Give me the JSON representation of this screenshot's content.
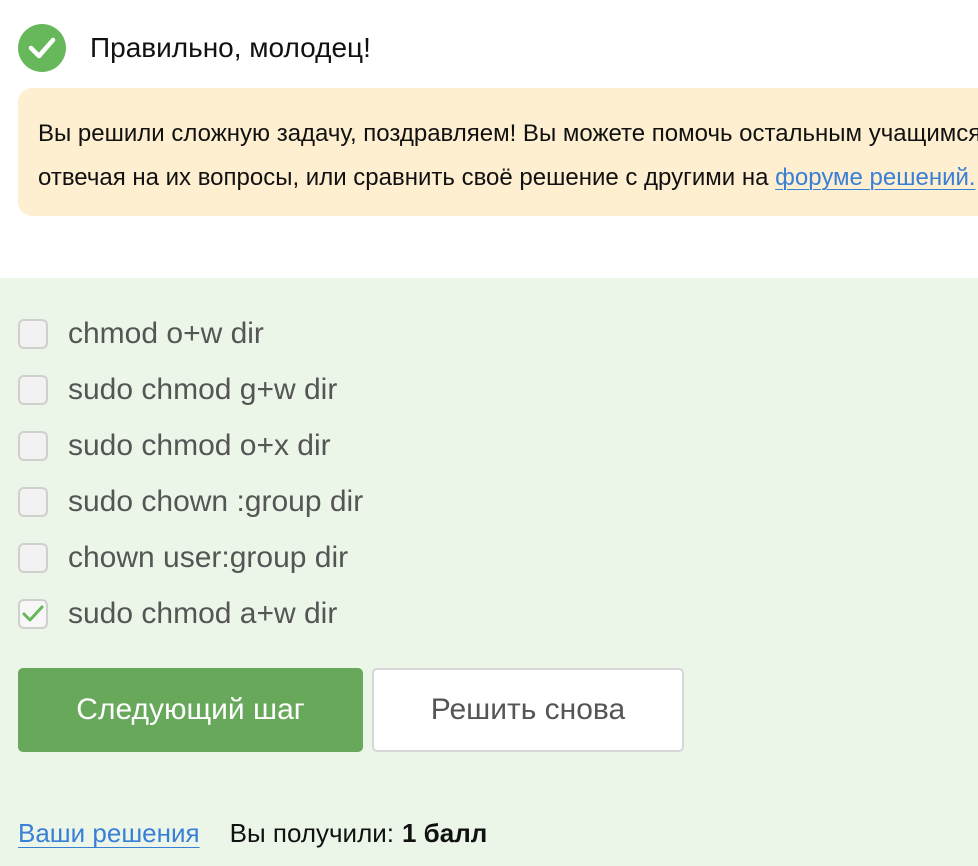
{
  "result": {
    "title": "Правильно, молодец!",
    "icon": "checkmark-circle-icon",
    "color": "#66b85a"
  },
  "hint": {
    "line1": "Вы решили сложную задачу, поздравляем! Вы можете помочь остальным учащимся в комментариях,",
    "line2_text": "отвечая на их вопросы, или сравнить своё решение с другими на ",
    "forum_link": "форуме решений."
  },
  "quiz": {
    "options": [
      {
        "label": "chmod o+w dir",
        "checked": false
      },
      {
        "label": "sudo chmod g+w dir",
        "checked": false
      },
      {
        "label": "sudo chmod o+x dir",
        "checked": false
      },
      {
        "label": "sudo chown :group dir",
        "checked": false
      },
      {
        "label": "chown user:group dir",
        "checked": false
      },
      {
        "label": "sudo chmod a+w dir",
        "checked": true
      }
    ],
    "next_button": "Следующий шаг",
    "retry_button": "Решить снова"
  },
  "footer": {
    "solutions_link": "Ваши решения",
    "score_label": "Вы получили:",
    "score_value": "1 балл"
  },
  "colors": {
    "accent": "#67a85b",
    "hint_background": "#fdefd0",
    "panel_background": "#ebf6e9",
    "link": "#3a7fd6"
  }
}
